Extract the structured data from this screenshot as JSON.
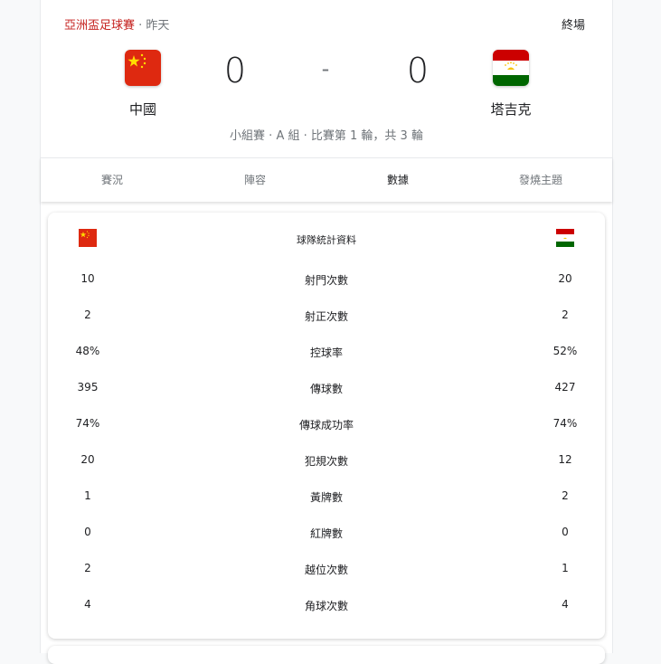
{
  "header": {
    "league": "亞洲盃足球賽",
    "separator": " · ",
    "date": "昨天",
    "status": "終場"
  },
  "match": {
    "home": {
      "name": "中國",
      "flag": "china-flag-icon",
      "score": "0"
    },
    "away": {
      "name": "塔吉克",
      "flag": "tajikistan-flag-icon",
      "score": "0"
    },
    "dash": "-",
    "round_info": "小組賽 · A 組 · 比賽第 1 輪，共 3 輪"
  },
  "tabs": [
    {
      "label": "賽況",
      "active": false
    },
    {
      "label": "陣容",
      "active": false
    },
    {
      "label": "數據",
      "active": true
    },
    {
      "label": "發燒主題",
      "active": false
    }
  ],
  "stats": {
    "title": "球隊統計資料",
    "rows": [
      {
        "label": "射門次數",
        "home": "10",
        "away": "20"
      },
      {
        "label": "射正次數",
        "home": "2",
        "away": "2"
      },
      {
        "label": "控球率",
        "home": "48%",
        "away": "52%"
      },
      {
        "label": "傳球數",
        "home": "395",
        "away": "427"
      },
      {
        "label": "傳球成功率",
        "home": "74%",
        "away": "74%"
      },
      {
        "label": "犯規次數",
        "home": "20",
        "away": "12"
      },
      {
        "label": "黃牌數",
        "home": "1",
        "away": "2"
      },
      {
        "label": "紅牌數",
        "home": "0",
        "away": "0"
      },
      {
        "label": "越位次數",
        "home": "2",
        "away": "1"
      },
      {
        "label": "角球次數",
        "home": "4",
        "away": "4"
      }
    ]
  },
  "colors": {
    "league": "#c5221f",
    "china_red": "#de2910",
    "china_star": "#ffde00",
    "tajik_red": "#cc0000",
    "tajik_green": "#006600",
    "tajik_gold": "#f8c300"
  }
}
